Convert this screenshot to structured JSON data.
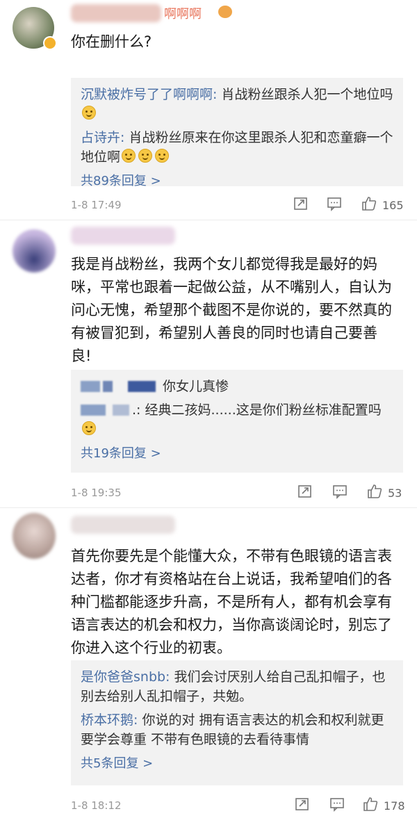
{
  "comments": [
    {
      "name_suffix": "啊啊啊",
      "text": "你在删什么?",
      "replies": [
        {
          "who": "沉默被炸号了了啊啊啊:",
          "text": " 肖战粉丝跟杀人犯一个地位吗"
        },
        {
          "who": "占诗卉:",
          "text": " 肖战粉丝原来在你这里跟杀人犯和恋童癖一个地位啊"
        }
      ],
      "more": "共89条回复 >",
      "time": "1-8 17:49",
      "likes": "165"
    },
    {
      "text": "我是肖战粉丝，我两个女儿都觉得我是最好的妈咪，平常也跟着一起做公益，从不嘴别人，自认为问心无愧，希望那个截图不是你说的，要不然真的有被冒犯到，希望别人善良的同时也请自己要善良!",
      "replies": [
        {
          "who": "",
          "text": "你女儿真惨"
        },
        {
          "who": ".:",
          "text": " 经典二孩妈......这是你们粉丝标准配置吗"
        }
      ],
      "more": "共19条回复 >",
      "time": "1-8 19:35",
      "likes": "53"
    },
    {
      "text": "首先你要先是个能懂大众，不带有色眼镜的语言表达者，你才有资格站在台上说话，我希望咱们的各种门槛都能逐步升高，不是所有人，都有机会享有语言表达的机会和权力，当你高谈阔论时，别忘了你进入这个行业的初衷。",
      "replies": [
        {
          "who": "是你爸爸snbb:",
          "text": " 我们会讨厌别人给自己乱扣帽子，也别去给别人乱扣帽子，共勉。"
        },
        {
          "who": "桥本环鹅:",
          "text": " 你说的对 拥有语言表达的机会和权利就更要学会尊重 不带有色眼镜的去看待事情"
        }
      ],
      "more": "共5条回复 >",
      "time": "1-8 18:12",
      "likes": "178"
    }
  ],
  "icons": {
    "share": "share-icon",
    "comment": "comment-icon",
    "like": "like-icon"
  }
}
